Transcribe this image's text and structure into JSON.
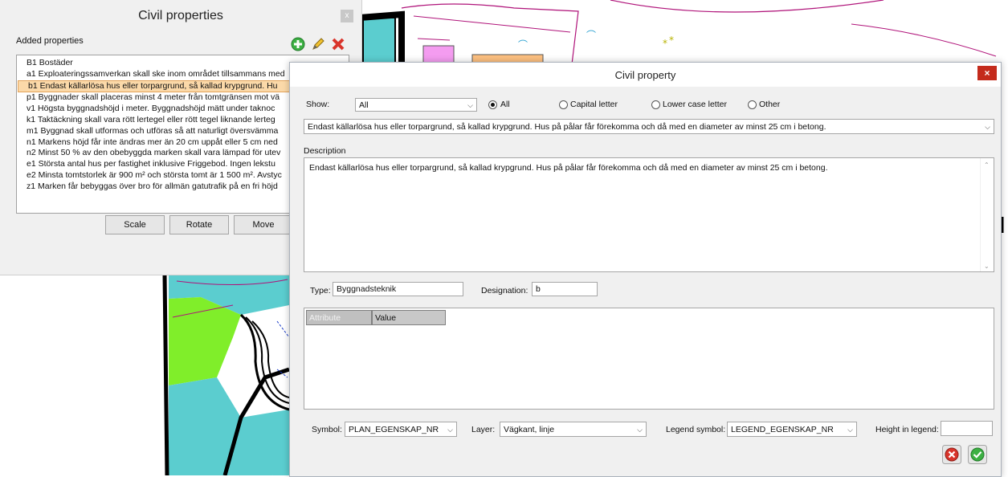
{
  "left_panel": {
    "title": "Civil properties",
    "close_label": "x",
    "added_label": "Added properties",
    "items": [
      "B1 Bostäder",
      "a1 Exploateringssamverkan skall ske inom området tillsammans med",
      "b1 Endast källarlösa hus eller torpargrund, så kallad krypgrund. Hu",
      "p1 Byggnader skall placeras minst 4 meter från tomtgränsen mot vä",
      "v1 Högsta byggnadshöjd i meter. Byggnadshöjd mätt under taknoc",
      "k1 Taktäckning skall vara rött lertegel eller rött tegel liknande lerteg",
      "m1 Byggnad skall utformas och utföras så att naturligt översvämma",
      "n1 Markens höjd får inte ändras mer än 20 cm uppåt eller 5 cm ned",
      "n2 Minst 50 % av den obebyggda marken skall vara lämpad för utev",
      "e1 Största antal hus per fastighet inklusive Friggebod. Ingen lekstu",
      "e2 Minsta tomtstorlek är 900 m² och största tomt är 1 500 m². Avstyc",
      "z1 Marken får bebyggas över bro för allmän gatutrafik på en fri höjd"
    ],
    "selected_index": 2,
    "buttons": {
      "scale": "Scale",
      "rotate": "Rotate",
      "move": "Move"
    }
  },
  "dialog": {
    "title": "Civil property",
    "close_label": "×",
    "show_label": "Show:",
    "show_value": "All",
    "radios": [
      {
        "label": "All",
        "checked": true
      },
      {
        "label": "Capital letter",
        "checked": false
      },
      {
        "label": "Lower case letter",
        "checked": false
      },
      {
        "label": "Other",
        "checked": false
      }
    ],
    "property_select": "Endast källarlösa hus eller torpargrund, så kallad krypgrund. Hus på pålar får förekomma och då med en diameter av minst 25 cm i betong.",
    "description_label": "Description",
    "description_text": "Endast källarlösa hus eller torpargrund, så kallad krypgrund. Hus på pålar får förekomma och då med en diameter av minst 25 cm i betong.",
    "type_label": "Type:",
    "type_value": "Byggnadsteknik",
    "designation_label": "Designation:",
    "designation_value": "b",
    "attr_headers": {
      "attribute": "Attribute",
      "value": "Value"
    },
    "symbol_label": "Symbol:",
    "symbol_value": "PLAN_EGENSKAP_NR",
    "layer_label": "Layer:",
    "layer_value": "Vägkant, linje",
    "legend_label": "Legend symbol:",
    "legend_value": "LEGEND_EGENSKAP_NR",
    "height_label": "Height in legend:",
    "height_value": ""
  },
  "colors": {
    "selection_bg": "#fbd9a9",
    "map_green": "#80ee2a",
    "map_teal": "#5bcdcf",
    "map_magenta": "#b0147a",
    "cancel_red": "#d9342b",
    "ok_green": "#3cb043"
  }
}
